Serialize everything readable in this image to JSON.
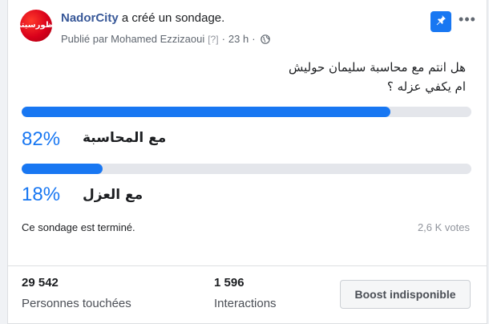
{
  "post": {
    "page_name": "NadorCity",
    "action": "a créé un sondage.",
    "published_by": "Publié par Mohamed Ezzizaoui",
    "help_marker": "[?]",
    "separator": "·",
    "time": "23 h",
    "separator2": "·",
    "avatar_text": "ناظورسيتي",
    "more_label": "•••"
  },
  "poll": {
    "question_line1": "هل انتم مع محاسبة سليمان حوليش",
    "question_line2": "ام يكفي عزله ؟",
    "options": [
      {
        "percent_label": "82%",
        "label": "مع المحاسبة",
        "fraction": 0.82
      },
      {
        "percent_label": "18%",
        "label": "مع العزل",
        "fraction": 0.18
      }
    ],
    "status": "Ce sondage est terminé.",
    "votes": "2,6 K votes"
  },
  "stats": {
    "reach_value": "29 542",
    "reach_label": "Personnes touchées",
    "interactions_value": "1 596",
    "interactions_label": "Interactions",
    "boost_label": "Boost indisponible"
  },
  "colors": {
    "accent": "#1877f2",
    "page_name": "#385898",
    "track": "#e4e6eb"
  },
  "icons": {
    "pin": "pin-icon",
    "globe": "globe-icon",
    "more": "more-icon"
  }
}
